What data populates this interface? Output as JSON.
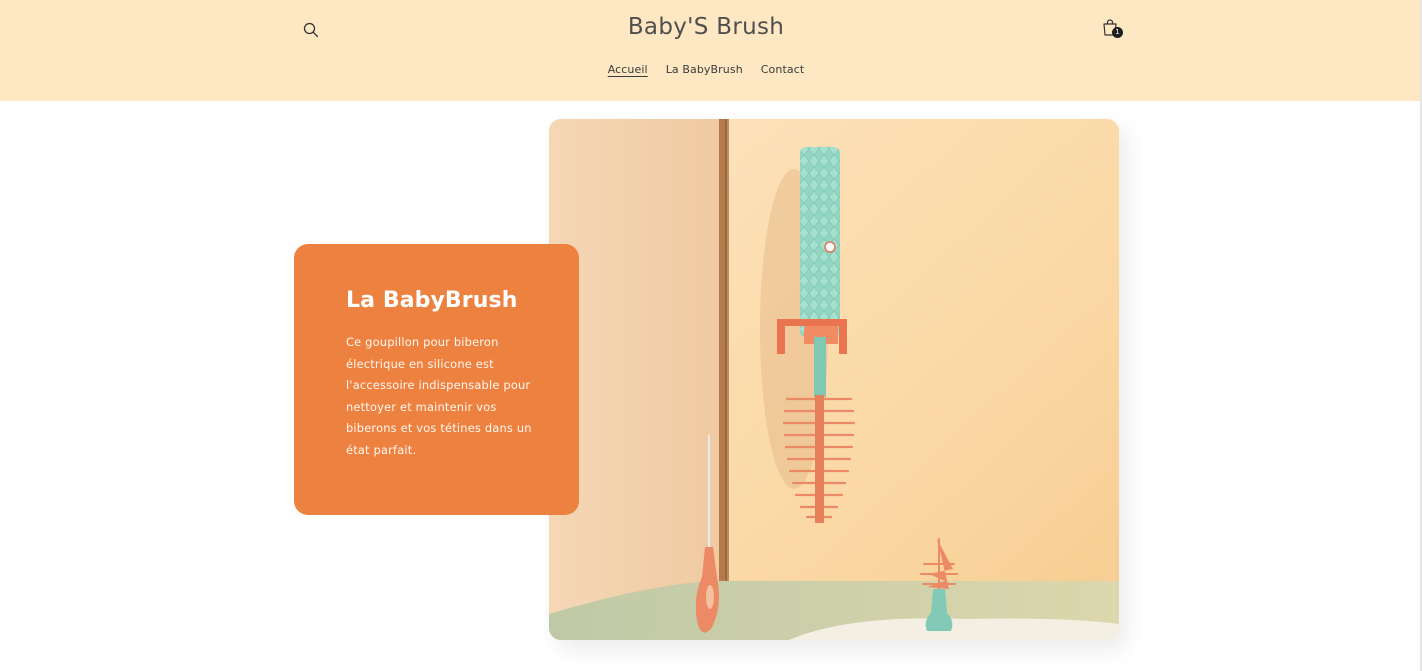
{
  "header": {
    "brand": "Baby'S Brush",
    "cart_count": "1",
    "nav": [
      {
        "label": "Accueil",
        "active": true
      },
      {
        "label": "La BabyBrush",
        "active": false
      },
      {
        "label": "Contact",
        "active": false
      }
    ],
    "icons": {
      "search": "search-icon",
      "cart": "shopping-bag-icon"
    }
  },
  "hero": {
    "card_title": "La BabyBrush",
    "card_text": "Ce goupillon pour biberon électrique en silicone est l'accessoire indispensable pour nettoyer et maintenir vos biberons et vos tétines dans un état parfait."
  },
  "colors": {
    "header_bg": "#fde8c3",
    "card_bg": "#ed8240",
    "card_text": "#ffffff",
    "brush_handle": "#8fd3bf",
    "bristles": "#ec8a65"
  }
}
